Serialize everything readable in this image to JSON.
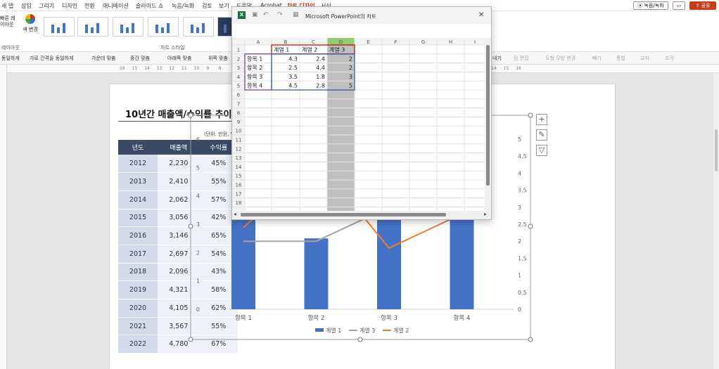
{
  "ribbon": {
    "tabs": [
      "새 탭",
      "삽입",
      "그리기",
      "디자인",
      "전환",
      "애니메이션",
      "슬라이드 쇼",
      "녹음/녹화",
      "검토",
      "보기",
      "도움말",
      "Acrobat",
      "차트 디자인",
      "서식"
    ],
    "active_tab": "차트 디자인",
    "record_label": "녹음/녹화",
    "share_label": "공유",
    "layout_label": "빠른 레이아웃",
    "color_change_label": "색 변경",
    "chart_styles_label": "차트 스타일",
    "group_label_left": "레이아웃"
  },
  "format_toolbar": {
    "items": [
      "동일하게",
      "가로 간격을 동일하게",
      "가운데 맞춤",
      "중간 맞춤",
      "아래쪽 맞춤",
      "위쪽 맞춤"
    ],
    "right_items": [
      "내기",
      "점 편집",
      "도형 모양 변경",
      "빼기",
      "통합",
      "교차",
      "조각"
    ]
  },
  "ruler": {
    "labels": [
      "16",
      "15",
      "14",
      "13",
      "12",
      "11",
      "10",
      "9",
      "8",
      "7",
      "6",
      "5",
      "4",
      "3",
      "2",
      "1",
      "0",
      "1",
      "2",
      "3",
      "4",
      "5",
      "6",
      "7",
      "8",
      "9",
      "10",
      "11",
      "12",
      "13",
      "14",
      "15",
      "16"
    ]
  },
  "slide": {
    "title": "10년간 매출액/수익률 추이",
    "unit_note": "(단위: 만원, %)",
    "table": {
      "headers": [
        "년도",
        "매출액",
        "수익률"
      ],
      "rows": [
        [
          "2012",
          "2,230",
          "45%"
        ],
        [
          "2013",
          "2,410",
          "55%"
        ],
        [
          "2014",
          "2,062",
          "57%"
        ],
        [
          "2015",
          "3,056",
          "42%"
        ],
        [
          "2016",
          "3,146",
          "65%"
        ],
        [
          "2017",
          "2,697",
          "54%"
        ],
        [
          "2018",
          "2,096",
          "43%"
        ],
        [
          "2019",
          "4,321",
          "58%"
        ],
        [
          "2020",
          "4,105",
          "62%"
        ],
        [
          "2021",
          "3,567",
          "55%"
        ],
        [
          "2022",
          "4,780",
          "67%"
        ]
      ]
    }
  },
  "chart_data": {
    "type": "bar",
    "categories": [
      "항목 1",
      "항목 2",
      "항목 3",
      "항목 4"
    ],
    "series": [
      {
        "name": "계열 1",
        "type": "bar",
        "axis": "left",
        "values": [
          4.3,
          2.5,
          3.5,
          4.5
        ],
        "color": "#4472C4"
      },
      {
        "name": "계열 2",
        "type": "line",
        "axis": "right",
        "values": [
          2.4,
          4.4,
          1.8,
          2.8
        ],
        "color": "#ED7D31"
      },
      {
        "name": "계열 3",
        "type": "line",
        "axis": "right",
        "values": [
          2,
          2,
          3,
          5
        ],
        "color": "#A5A5A5"
      }
    ],
    "legend_order": [
      "계열 1",
      "계열 3",
      "계열 2"
    ],
    "left_axis": {
      "ticks": [
        "0",
        "1",
        "2",
        "3",
        "4",
        "5",
        "6"
      ],
      "range": [
        0,
        6
      ]
    },
    "right_axis": {
      "ticks": [
        "0",
        "0.5",
        "1",
        "1.5",
        "2",
        "2.5",
        "3",
        "3.5",
        "4",
        "4.5",
        "5"
      ],
      "range": [
        0,
        5
      ]
    },
    "legend_position": "bottom"
  },
  "chart_buttons": [
    "+",
    "✎",
    "▽"
  ],
  "excel": {
    "title": "Microsoft PowerPoint의 차트",
    "columns": [
      "A",
      "B",
      "C",
      "D",
      "E",
      "F",
      "G",
      "H",
      "I"
    ],
    "row_numbers": [
      "1",
      "2",
      "3",
      "4",
      "5",
      "6",
      "7",
      "8",
      "9",
      "10",
      "11",
      "12",
      "13",
      "14",
      "15",
      "16",
      "17",
      "18"
    ],
    "header_row": [
      "",
      "계열 1",
      "계열 2",
      "계열 3"
    ],
    "rows": [
      [
        "항목 1",
        "4.3",
        "2.4",
        "2"
      ],
      [
        "항목 2",
        "2.5",
        "4.4",
        "2"
      ],
      [
        "항목 3",
        "3.5",
        "1.8",
        "3"
      ],
      [
        "항목 4",
        "4.5",
        "2.8",
        "5"
      ]
    ],
    "selected_column": "D",
    "colors": {
      "header_select": "#8fce6b",
      "selection_fill": "#bfbfbf",
      "series_border": "#c00000",
      "category_border": "#7030a0",
      "values_border": "#2f5597"
    }
  }
}
